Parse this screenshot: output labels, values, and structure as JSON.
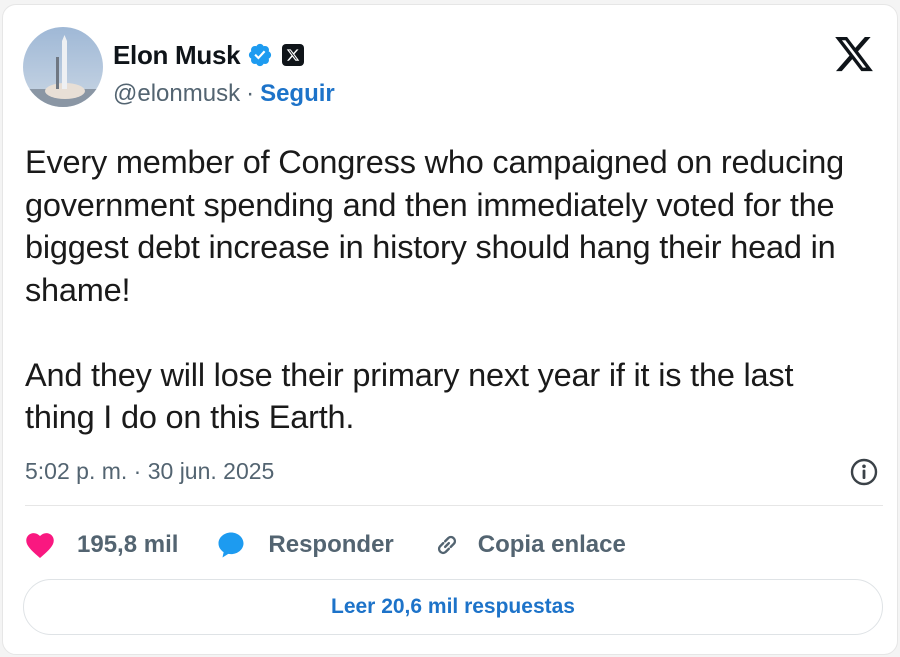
{
  "author": {
    "name": "Elon Musk",
    "handle": "@elonmusk",
    "separator": "·",
    "follow_label": "Seguir"
  },
  "tweet": {
    "text": "Every member of Congress who campaigned on reducing\ngovernment spending and then immediately voted for the\nbiggest debt increase in history should hang their head in\nshame!\n\nAnd they will lose their primary next year if it is the last\nthing I do on this Earth.",
    "timestamp": "5:02 p. m. · 30 jun. 2025"
  },
  "actions": {
    "likes": "195,8 mil",
    "reply_label": "Responder",
    "copy_link_label": "Copia enlace"
  },
  "read_replies_label": "Leer 20,6 mil respuestas",
  "colors": {
    "accent": "#1d73c9",
    "verified": "#1d9bf0",
    "heart": "#f91880",
    "text": "#0f1419",
    "muted": "#536471"
  },
  "icons": [
    "verified-badge-icon",
    "x-affiliate-badge-icon",
    "x-logo-icon",
    "info-icon",
    "heart-icon",
    "reply-bubble-icon",
    "link-icon"
  ]
}
